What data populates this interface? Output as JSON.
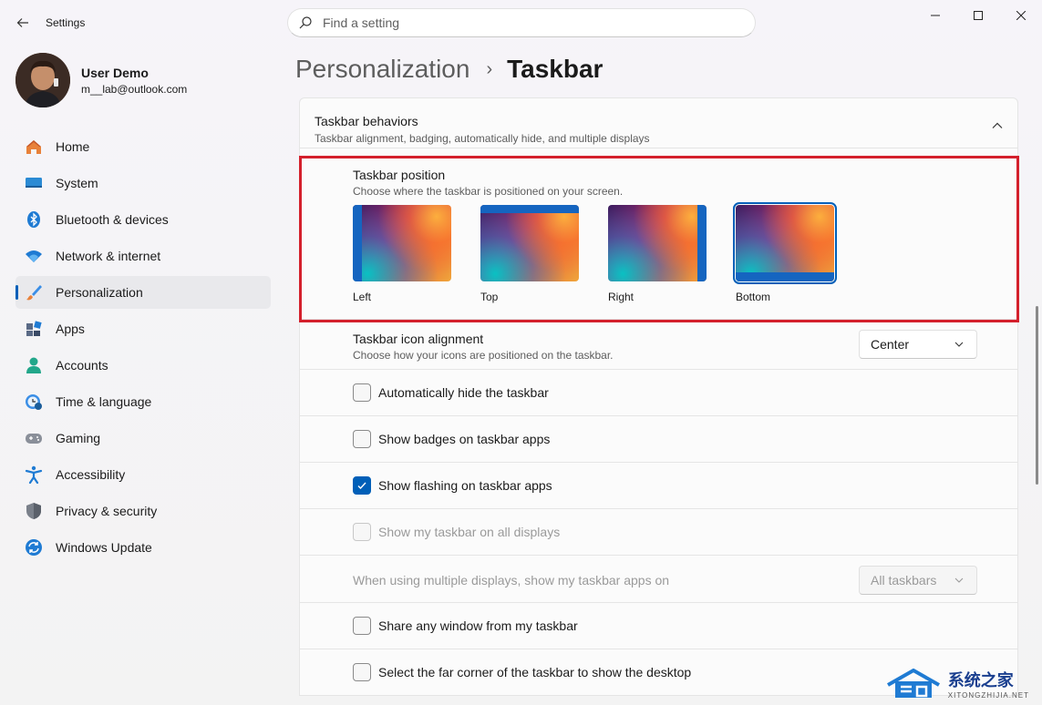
{
  "app": {
    "title": "Settings"
  },
  "search": {
    "placeholder": "Find a setting"
  },
  "profile": {
    "name": "User Demo",
    "email": "m__lab@outlook.com"
  },
  "nav": {
    "items": [
      {
        "label": "Home",
        "icon": "home-icon"
      },
      {
        "label": "System",
        "icon": "system-icon"
      },
      {
        "label": "Bluetooth & devices",
        "icon": "bluetooth-icon"
      },
      {
        "label": "Network & internet",
        "icon": "wifi-icon"
      },
      {
        "label": "Personalization",
        "icon": "brush-icon",
        "active": true
      },
      {
        "label": "Apps",
        "icon": "apps-icon"
      },
      {
        "label": "Accounts",
        "icon": "person-icon"
      },
      {
        "label": "Time & language",
        "icon": "clock-globe-icon"
      },
      {
        "label": "Gaming",
        "icon": "gamepad-icon"
      },
      {
        "label": "Accessibility",
        "icon": "accessibility-icon"
      },
      {
        "label": "Privacy & security",
        "icon": "shield-icon"
      },
      {
        "label": "Windows Update",
        "icon": "update-icon"
      }
    ]
  },
  "breadcrumb": {
    "parent": "Personalization",
    "separator": "›",
    "current": "Taskbar"
  },
  "behaviors": {
    "title": "Taskbar behaviors",
    "description": "Taskbar alignment, badging, automatically hide, and multiple displays",
    "position": {
      "title": "Taskbar position",
      "description": "Choose where the taskbar is positioned on your screen.",
      "options": [
        {
          "label": "Left",
          "selected": false
        },
        {
          "label": "Top",
          "selected": false
        },
        {
          "label": "Right",
          "selected": false
        },
        {
          "label": "Bottom",
          "selected": true
        }
      ]
    },
    "alignment": {
      "title": "Taskbar icon alignment",
      "description": "Choose how your icons are positioned on the taskbar.",
      "value": "Center"
    },
    "checkboxes": [
      {
        "label": "Automatically hide the taskbar",
        "checked": false,
        "disabled": false
      },
      {
        "label": "Show badges on taskbar apps",
        "checked": false,
        "disabled": false
      },
      {
        "label": "Show flashing on taskbar apps",
        "checked": true,
        "disabled": false
      },
      {
        "label": "Show my taskbar on all displays",
        "checked": false,
        "disabled": true
      }
    ],
    "multi_display": {
      "label": "When using multiple displays, show my taskbar apps on",
      "value": "All taskbars"
    },
    "checkboxes2": [
      {
        "label": "Share any window from my taskbar",
        "checked": false,
        "disabled": false
      },
      {
        "label": "Select the far corner of the taskbar to show the desktop",
        "checked": false,
        "disabled": false
      }
    ]
  },
  "watermark": {
    "cn": "系统之家",
    "en": "XITONGZHIJIA.NET"
  },
  "colors": {
    "accent": "#005fb8",
    "highlight": "#d4202c"
  }
}
